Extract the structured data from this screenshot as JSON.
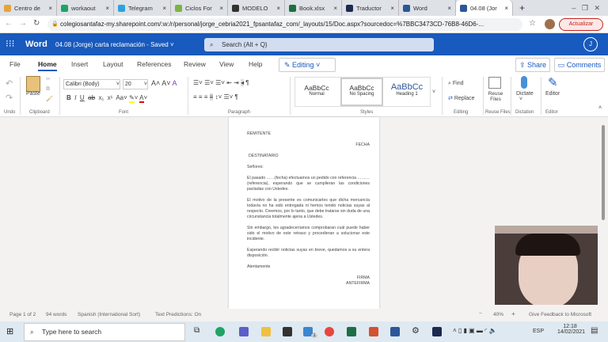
{
  "browser": {
    "tabs": [
      {
        "label": "Centro de",
        "color": "#e8a33d"
      },
      {
        "label": "workaout",
        "color": "#1fa463"
      },
      {
        "label": "Telegram",
        "color": "#2aa3df"
      },
      {
        "label": "Ciclos For",
        "color": "#7cb342"
      },
      {
        "label": "MODELO",
        "color": "#333333"
      },
      {
        "label": "Book.xlsx",
        "color": "#1d6f42"
      },
      {
        "label": "Traductor",
        "color": "#1b2a4e"
      },
      {
        "label": "Word",
        "color": "#2b579a"
      },
      {
        "label": "04.08 (Jor",
        "color": "#2b579a"
      }
    ],
    "new_tab": "+",
    "url": "colegiosantafaz-my.sharepoint.com/:w:/r/personal/jorge_cebria2021_fpsantafaz_com/_layouts/15/Doc.aspx?sourcedoc=%7BBC3473CD-76B8-46D6-...",
    "update": "Actualizar"
  },
  "word": {
    "app": "Word",
    "doc_title": "04.08 (Jorge) carta reclamación",
    "saved": "Saved",
    "search_placeholder": "Search (Alt + Q)",
    "avatar": "J",
    "brand_color": "#185abd"
  },
  "ribbon_tabs": [
    "File",
    "Home",
    "Insert",
    "Layout",
    "References",
    "Review",
    "View",
    "Help"
  ],
  "editing": "Editing",
  "share": "Share",
  "comments": "Comments",
  "ribbon": {
    "font": "Calibri (Body)",
    "size": "20",
    "paste": "Paste",
    "styles": [
      {
        "preview": "AaBbCc",
        "name": "Normal"
      },
      {
        "preview": "AaBbCc",
        "name": "No Spacing"
      },
      {
        "preview": "AaBbCc",
        "name": "Heading 1"
      }
    ],
    "find": "Find",
    "replace": "Replace",
    "reuse": "Reuse Files",
    "dictate": "Dictate",
    "editor": "Editor",
    "groups": [
      "Undo",
      "Clipboard",
      "Font",
      "Paragraph",
      "Styles",
      "Editing",
      "Reuse Files",
      "Dictation",
      "Editor"
    ]
  },
  "document": {
    "remitente": "REMITENTE",
    "fecha": "FECHA",
    "destinatario": "DESTINATARIO",
    "saludo": "Señores:",
    "paragraphs": [
      "El pasado ……(fecha) efectuamos un pedido con referencia ………(referencia), esperando que se cumplieran las condiciones pactadas con Ustedes.",
      "El motivo de la presente es comunicarles que dicha mercancía todavía no ha sido entregada ni hemos tenido noticias suyas al respecto. Creemos, por lo tanto, que debe tratarse sin duda de una circunstancia totalmente ajena a Ustedes.",
      "Sin embargo, les agradeceríamos comprobaran cuál puede haber sido el motivo de este retraso y procedieran a solucionar este incidente.",
      "Esperando recibir noticias suyas en breve, quedamos a su entera disposición."
    ],
    "despedida": "Atentamente",
    "firma": "FIRMA",
    "antefirma": "ANTEFIRMA"
  },
  "status": {
    "page": "Page 1 of 2",
    "words": "94 words",
    "language": "Spanish (International Sort)",
    "predictions": "Text Predictions: On",
    "zoom": "40%",
    "feedback": "Give Feedback to Microsoft"
  },
  "taskbar": {
    "search": "Type here to search",
    "lang": "ESP",
    "time": "12:18",
    "date": "14/02/2021",
    "mail_badge": "1"
  }
}
